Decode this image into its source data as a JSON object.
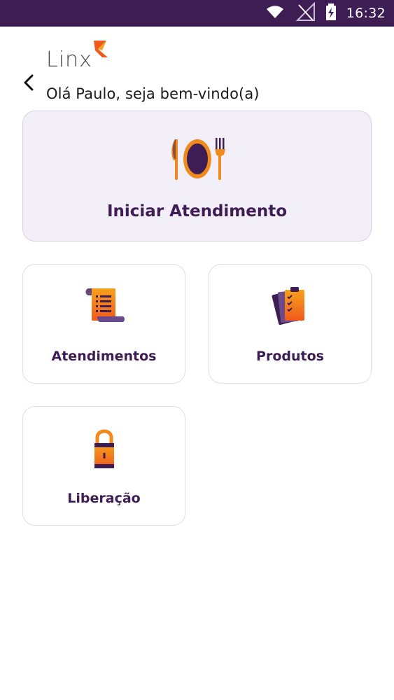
{
  "status_bar": {
    "time": "16:32",
    "icons": [
      "wifi-icon",
      "no-signal-icon",
      "battery-charging-icon"
    ],
    "background": "#3d1d54"
  },
  "header": {
    "back_icon": "chevron-left-icon",
    "logo_text": "Linx",
    "greeting": "Olá Paulo, seja bem-vindo(a)"
  },
  "menu": {
    "primary": {
      "label": "Iniciar Atendimento",
      "icon": "plate-cutlery-icon"
    },
    "items": [
      {
        "label": "Atendimentos",
        "icon": "scroll-list-icon"
      },
      {
        "label": "Produtos",
        "icon": "clipboard-checklist-icon"
      },
      {
        "label": "Liberação",
        "icon": "padlock-icon"
      }
    ]
  },
  "colors": {
    "accent": "#3d1d54",
    "orange": "#f08a1c",
    "card_primary_bg": "#f3eff8"
  }
}
